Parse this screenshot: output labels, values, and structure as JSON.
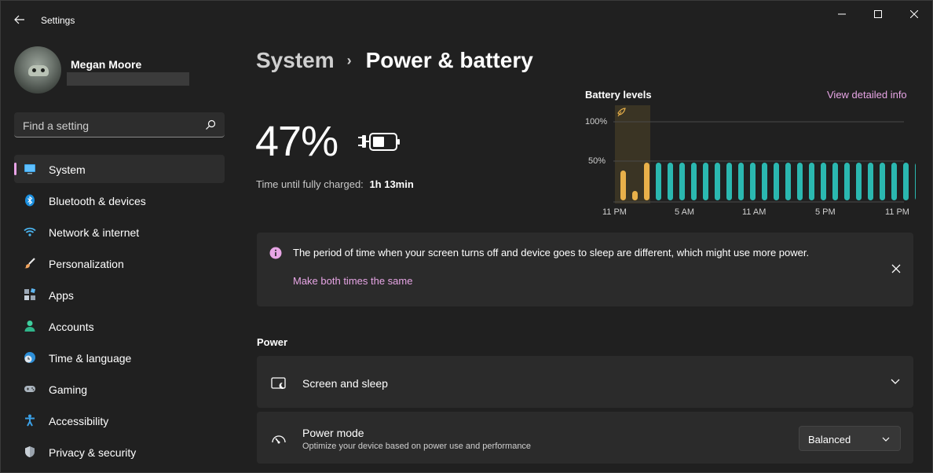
{
  "app": {
    "title": "Settings"
  },
  "profile": {
    "name": "Megan Moore"
  },
  "search": {
    "placeholder": "Find a setting"
  },
  "sidebar": {
    "items": [
      {
        "label": "System",
        "icon": "system-icon",
        "active": true
      },
      {
        "label": "Bluetooth & devices",
        "icon": "bluetooth-icon"
      },
      {
        "label": "Network & internet",
        "icon": "wifi-icon"
      },
      {
        "label": "Personalization",
        "icon": "brush-icon"
      },
      {
        "label": "Apps",
        "icon": "apps-icon"
      },
      {
        "label": "Accounts",
        "icon": "person-icon"
      },
      {
        "label": "Time & language",
        "icon": "globe-clock-icon"
      },
      {
        "label": "Gaming",
        "icon": "gamepad-icon"
      },
      {
        "label": "Accessibility",
        "icon": "accessibility-icon"
      },
      {
        "label": "Privacy & security",
        "icon": "shield-icon"
      }
    ]
  },
  "breadcrumb": {
    "parent": "System",
    "separator": "›",
    "current": "Power & battery"
  },
  "battery": {
    "percent": "47%",
    "charge_label": "Time until fully charged:",
    "charge_time": "1h 13min"
  },
  "battery_chart": {
    "title": "Battery levels",
    "link": "View detailed info",
    "y_ticks": [
      "100%",
      "50%"
    ],
    "x_ticks": [
      "11 PM",
      "5 AM",
      "11 AM",
      "5 PM",
      "11 PM"
    ]
  },
  "chart_data": {
    "type": "bar",
    "ylim": [
      0,
      100
    ],
    "y_ticks": [
      100,
      50
    ],
    "x_ticks": [
      "11 PM",
      "5 AM",
      "11 AM",
      "5 PM",
      "11 PM"
    ],
    "values": [
      38,
      12,
      48,
      48,
      48,
      48,
      48,
      48,
      48,
      48,
      48,
      48,
      48,
      48,
      48,
      48,
      48,
      48,
      48,
      48,
      48,
      48,
      48,
      48,
      48,
      48
    ],
    "low_power_bars": 3,
    "colors": {
      "low": "#e8b04a",
      "normal": "#2bb8b0",
      "highlight": "#3a3424"
    }
  },
  "notice": {
    "text": "The period of time when your screen turns off and device goes to sleep are different, which might use more power.",
    "link": "Make both times the same"
  },
  "power_section": {
    "title": "Power",
    "screen_sleep": {
      "label": "Screen and sleep"
    },
    "power_mode": {
      "label": "Power mode",
      "description": "Optimize your device based on power use and performance",
      "value": "Balanced"
    }
  },
  "colors": {
    "accent": "#e9a3e6",
    "background": "#202020",
    "card": "#2b2b2b"
  }
}
